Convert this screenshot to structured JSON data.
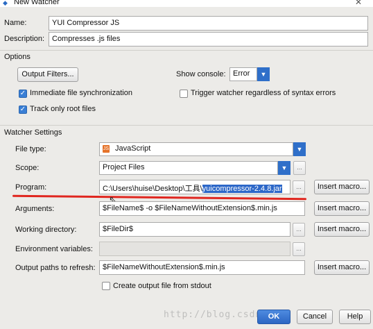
{
  "window": {
    "title": "New Watcher"
  },
  "name_row": {
    "label": "Name:",
    "value": "YUI Compressor JS"
  },
  "description_row": {
    "label": "Description:",
    "value": "Compresses .js files"
  },
  "options": {
    "heading": "Options",
    "output_filters_label": "Output Filters...",
    "show_console_label": "Show console:",
    "show_console_value": "Error",
    "immediate_sync_label": "Immediate file synchronization",
    "immediate_sync_checked": true,
    "trigger_watcher_label": "Trigger watcher regardless of syntax errors",
    "trigger_watcher_checked": false,
    "track_root_label": "Track only root files",
    "track_root_checked": true
  },
  "watcher_settings": {
    "heading": "Watcher Settings",
    "file_type_label": "File type:",
    "file_type_value": "JavaScript",
    "scope_label": "Scope:",
    "scope_value": "Project Files",
    "program_label": "Program:",
    "program_prefix": "C:\\Users\\huise\\Desktop\\工具\\",
    "program_selected": "yuicompressor-2.4.8.jar",
    "arguments_label": "Arguments:",
    "arguments_value": "$FileName$ -o $FileNameWithoutExtension$.min.js",
    "working_dir_label": "Working directory:",
    "working_dir_value": "$FileDir$",
    "env_vars_label": "Environment variables:",
    "env_vars_value": "",
    "output_paths_label": "Output paths to refresh:",
    "output_paths_value": "$FileNameWithoutExtension$.min.js",
    "create_output_label": "Create output file from stdout",
    "create_output_checked": false,
    "insert_macro_label": "Insert macro...",
    "browse_label": "..."
  },
  "footer": {
    "ok_label": "OK",
    "cancel_label": "Cancel",
    "help_label": "Help",
    "watermark": "http://blog.csdn.net/"
  },
  "colors": {
    "accent": "#2c67c8",
    "annotation_line": "#e0261f"
  }
}
